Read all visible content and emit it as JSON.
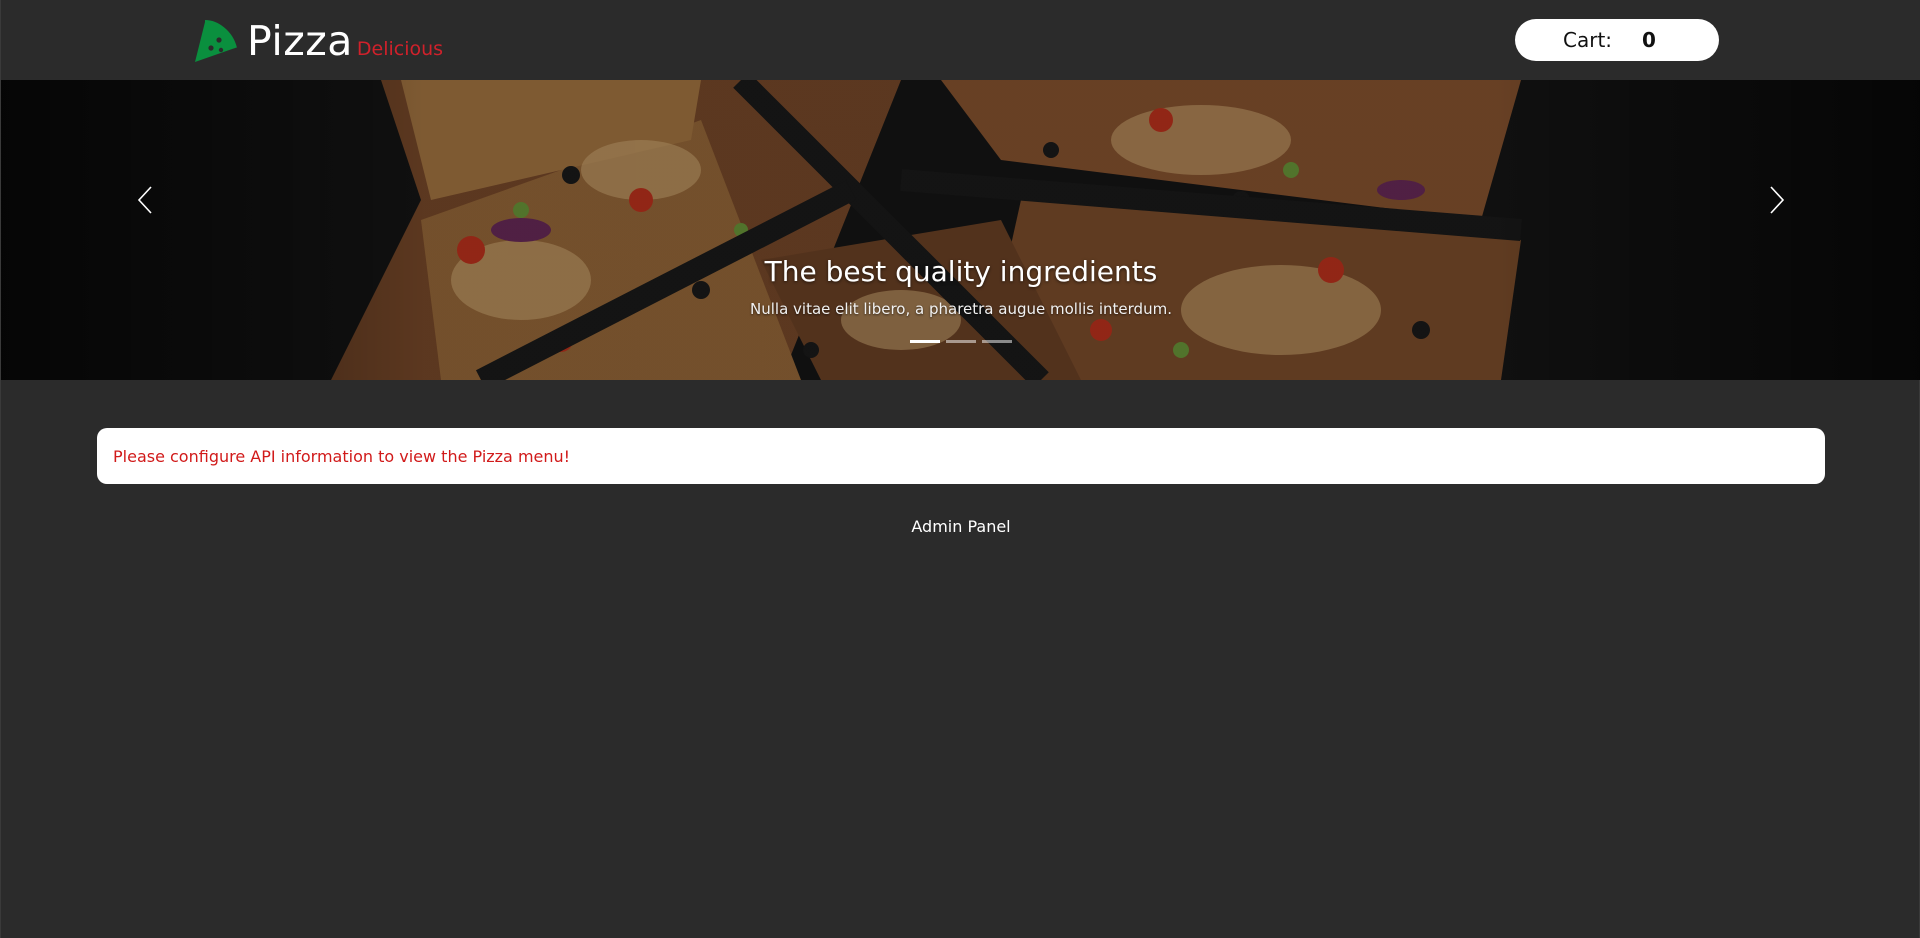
{
  "header": {
    "brand_name": "Pizza",
    "brand_tagline": "Delicious",
    "logo_icon": "pizza-slice-icon",
    "brand_color": "#0a8f3e",
    "tagline_color": "#d0212b",
    "cart_label": "Cart:",
    "cart_count": "0"
  },
  "carousel": {
    "title": "The best quality ingredients",
    "text": "Nulla vitae elit libero, a pharetra augue mollis interdum.",
    "prev_icon": "chevron-left-icon",
    "next_icon": "chevron-right-icon",
    "slide_count": 3,
    "active_index": 0
  },
  "alert": {
    "message": "Please configure API information to view the Pizza menu!",
    "color": "#d11a1a"
  },
  "footer": {
    "admin_label": "Admin Panel"
  }
}
